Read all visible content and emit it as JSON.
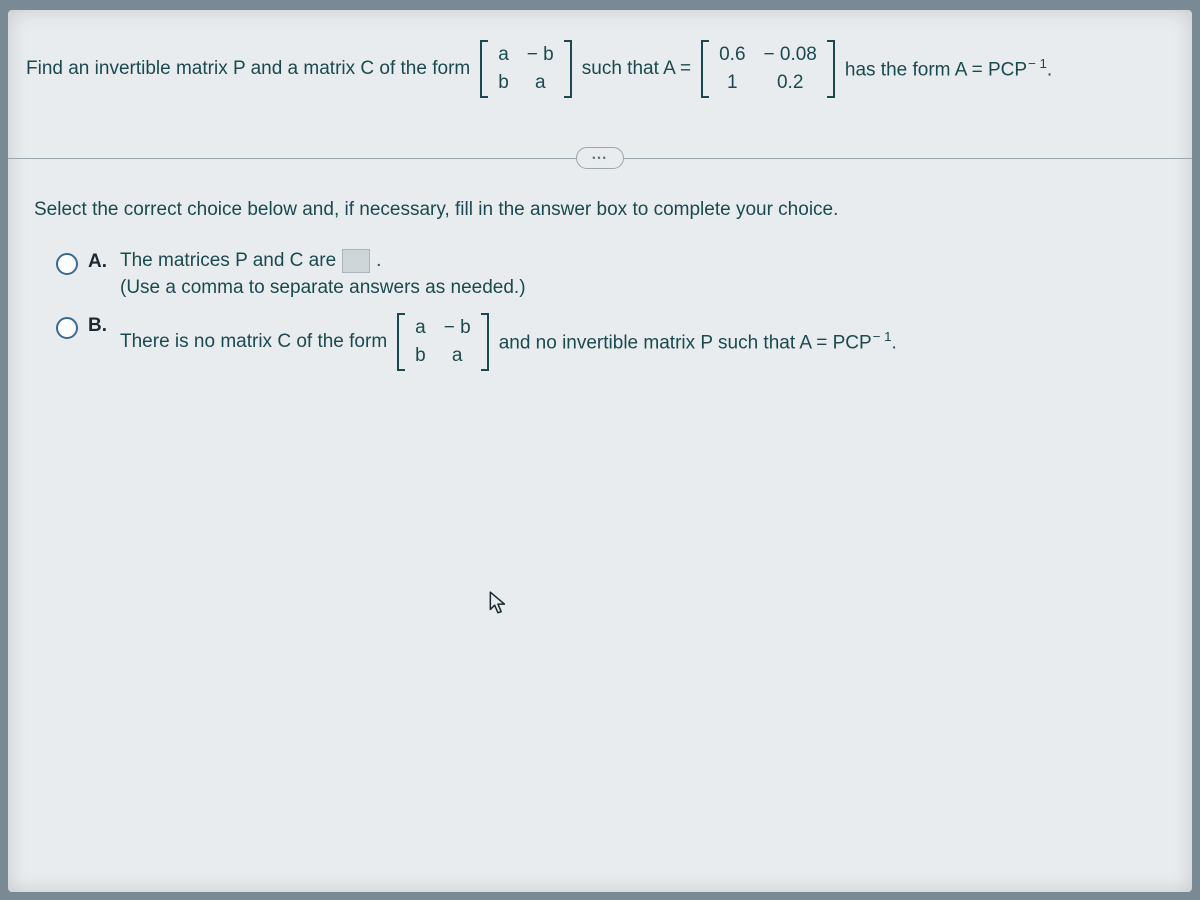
{
  "question": {
    "t1": "Find an invertible matrix P and a matrix C of the form",
    "m1": {
      "r1c1": "a",
      "r1c2": "− b",
      "r2c1": "b",
      "r2c2": "a"
    },
    "t2": "such that A =",
    "m2": {
      "r1c1": "0.6",
      "r1c2": "− 0.08",
      "r2c1": "1",
      "r2c2": "0.2"
    },
    "t3": "has the form A = PCP",
    "exp": "− 1",
    "t4": "."
  },
  "pill": "•••",
  "instruction": "Select the correct choice below and, if necessary, fill in the answer box to complete your choice.",
  "choices": {
    "a": {
      "label": "A.",
      "line1a": "The matrices P and C are",
      "line1b": ".",
      "hint": "(Use a comma to separate answers as needed.)"
    },
    "b": {
      "label": "B.",
      "t1": "There is no matrix C of the form",
      "m": {
        "r1c1": "a",
        "r1c2": "− b",
        "r2c1": "b",
        "r2c2": "a"
      },
      "t2": "and no invertible matrix P such that A = PCP",
      "exp": "− 1",
      "t3": "."
    }
  }
}
